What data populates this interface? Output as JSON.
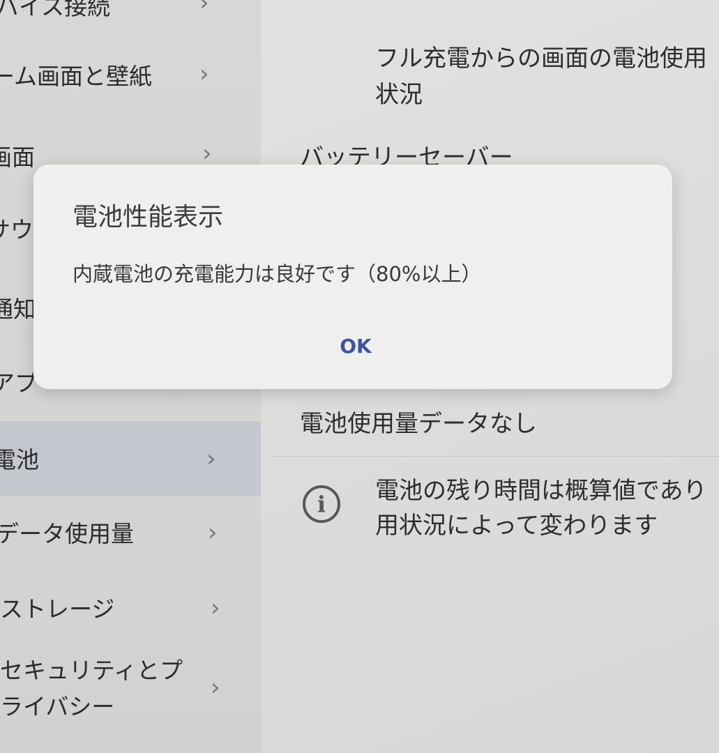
{
  "sidebar": {
    "items": [
      {
        "label": "バイス接続"
      },
      {
        "label": "ーム画面と壁紙"
      },
      {
        "label": "画面"
      },
      {
        "label": "サウ"
      },
      {
        "label": "通知"
      },
      {
        "label": "アプ"
      },
      {
        "label": "電池",
        "selected": true
      },
      {
        "label": "データ使用量"
      },
      {
        "label": "ストレージ"
      },
      {
        "label": "セキュリティとプ",
        "label2": "ライバシー"
      }
    ]
  },
  "main": {
    "usage_line1": "フル充電からの画面の電池使用",
    "usage_line2": "状況",
    "battery_saver": "バッテリーセーバー",
    "no_data": "電池使用量データなし",
    "info_line1": "電池の残り時間は概算値であり",
    "info_line2": "用状況によって変わります",
    "info_icon_glyph": "i"
  },
  "dialog": {
    "title": "電池性能表示",
    "message": "内蔵電池の充電能力は良好です（80%以上）",
    "ok_label": "OK"
  },
  "icons": {
    "chevron": "›"
  },
  "colors": {
    "accent": "#3d55a0",
    "selected_bg": "#c9cbd3"
  }
}
